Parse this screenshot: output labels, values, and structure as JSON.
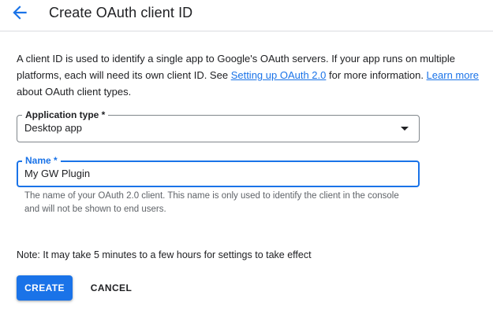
{
  "header": {
    "back_icon": "arrow-back-icon",
    "title": "Create OAuth client ID"
  },
  "intro": {
    "text_1": "A client ID is used to identify a single app to Google's OAuth servers. If your app runs on multiple platforms, each will need its own client ID. See ",
    "link_setup": "Setting up OAuth 2.0",
    "text_2": " for more information. ",
    "link_learn": "Learn more",
    "text_3": " about OAuth client types."
  },
  "application_type": {
    "label": "Application type *",
    "value": "Desktop app",
    "icon": "dropdown-arrow-icon"
  },
  "name": {
    "label": "Name *",
    "value": "My GW Plugin",
    "helper": "The name of your OAuth 2.0 client. This name is only used to identify the client in the console and will not be shown to end users."
  },
  "note": "Note: It may take 5 minutes to a few hours for settings to take effect",
  "actions": {
    "create_label": "CREATE",
    "cancel_label": "CANCEL"
  },
  "colors": {
    "accent": "#1a73e8",
    "text": "#202124",
    "secondary_text": "#5f6368",
    "border": "#80868b"
  }
}
